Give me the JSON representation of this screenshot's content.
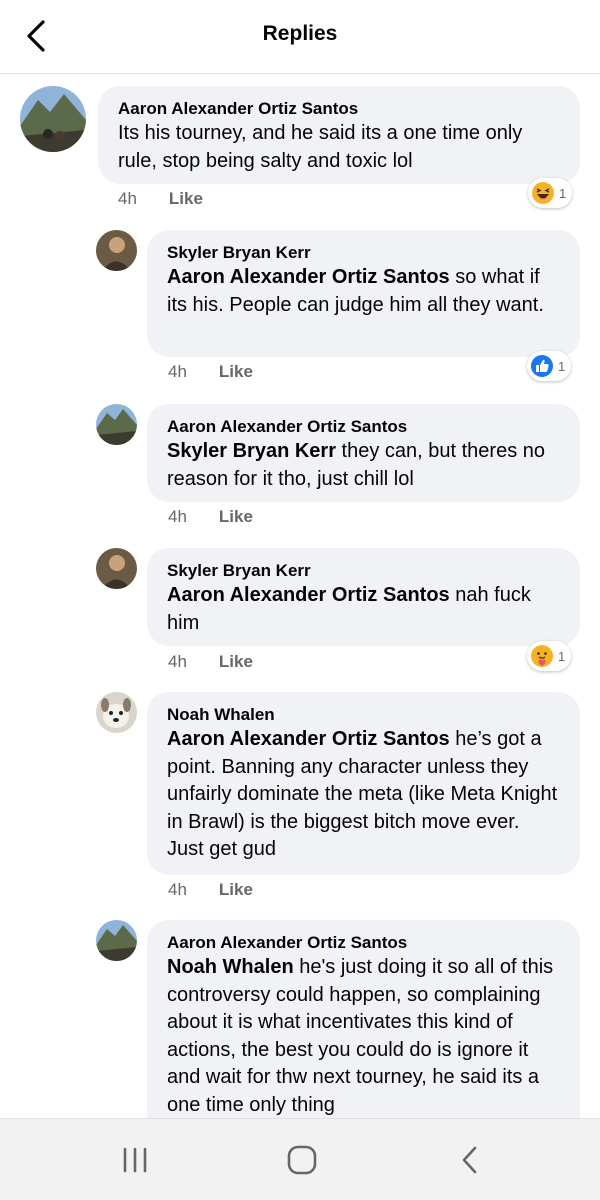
{
  "header": {
    "title": "Replies"
  },
  "comments": [
    {
      "author": "Aaron Alexander Ortiz Santos",
      "mention": "",
      "text": "Its his tourney, and he said its a one time only rule, stop being salty and toxic lol",
      "time": "4h",
      "like_label": "Like",
      "reaction": {
        "type": "haha",
        "count": "1"
      }
    },
    {
      "author": "Skyler Bryan Kerr",
      "mention": "Aaron Alexander Ortiz Santos",
      "text": " so what if its his. People can judge him all they want.",
      "time": "4h",
      "like_label": "Like",
      "reaction": {
        "type": "like",
        "count": "1"
      }
    },
    {
      "author": "Aaron Alexander Ortiz Santos",
      "mention": "Skyler Bryan Kerr",
      "text": " they can, but theres no reason for it tho, just chill lol",
      "time": "4h",
      "like_label": "Like"
    },
    {
      "author": "Skyler Bryan Kerr",
      "mention": "Aaron Alexander Ortiz Santos",
      "text": " nah fuck him",
      "time": "4h",
      "like_label": "Like",
      "reaction": {
        "type": "care",
        "count": "1"
      }
    },
    {
      "author": "Noah Whalen",
      "mention": "Aaron Alexander Ortiz Santos",
      "text": " he’s got a point. Banning any character unless they unfairly dominate the meta (like Meta Knight in Brawl) is the biggest bitch move ever. Just get gud",
      "time": "4h",
      "like_label": "Like"
    },
    {
      "author": "Aaron Alexander Ortiz Santos",
      "mention": "Noah Whalen",
      "text": " he's just doing it so all of this controversy could happen, so complaining about it is what incentivates this kind of actions, the best you could do is ignore it and wait for thw next tourney, he said its a one time only thing"
    }
  ],
  "colors": {
    "bubble": "#f0f2f5",
    "meta_text": "#65676b",
    "like_blue": "#1877f2",
    "haha_yellow": "#f7b125"
  },
  "icons": {
    "back": "chevron-left-icon",
    "nav_recent": "recent-apps-icon",
    "nav_home": "home-icon",
    "nav_back": "nav-back-icon"
  }
}
